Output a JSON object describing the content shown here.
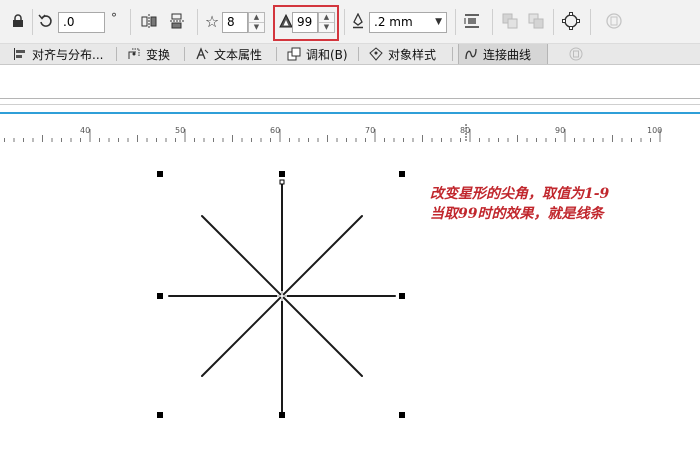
{
  "property_bar": {
    "rotation_value": ".0",
    "degree_symbol": "°",
    "star_points_value": "8",
    "star_sharpness_value": "99",
    "outline_width_value": ".2 mm"
  },
  "docker_tabs": [
    {
      "label": "对齐与分布...",
      "icon": "align-icon",
      "active": false
    },
    {
      "label": "变换",
      "icon": "transform-icon",
      "active": false
    },
    {
      "label": "文本属性",
      "icon": "text-properties-icon",
      "active": false
    },
    {
      "label": "调和(B)",
      "icon": "blend-icon",
      "active": false
    },
    {
      "label": "对象样式",
      "icon": "object-styles-icon",
      "active": false
    },
    {
      "label": "连接曲线",
      "icon": "connect-curves-icon",
      "active": true
    }
  ],
  "ruler": {
    "labels": [
      "40",
      "50",
      "60",
      "70",
      "80",
      "90",
      "100"
    ]
  },
  "annotation": {
    "line1": "改变星形的尖角，取值为1-9",
    "line2": "当取99时的效果，就是线条"
  },
  "colors": {
    "highlight": "#d3353d",
    "annotation_text": "#c1272d",
    "ruler_accent": "#2f9fd8"
  }
}
